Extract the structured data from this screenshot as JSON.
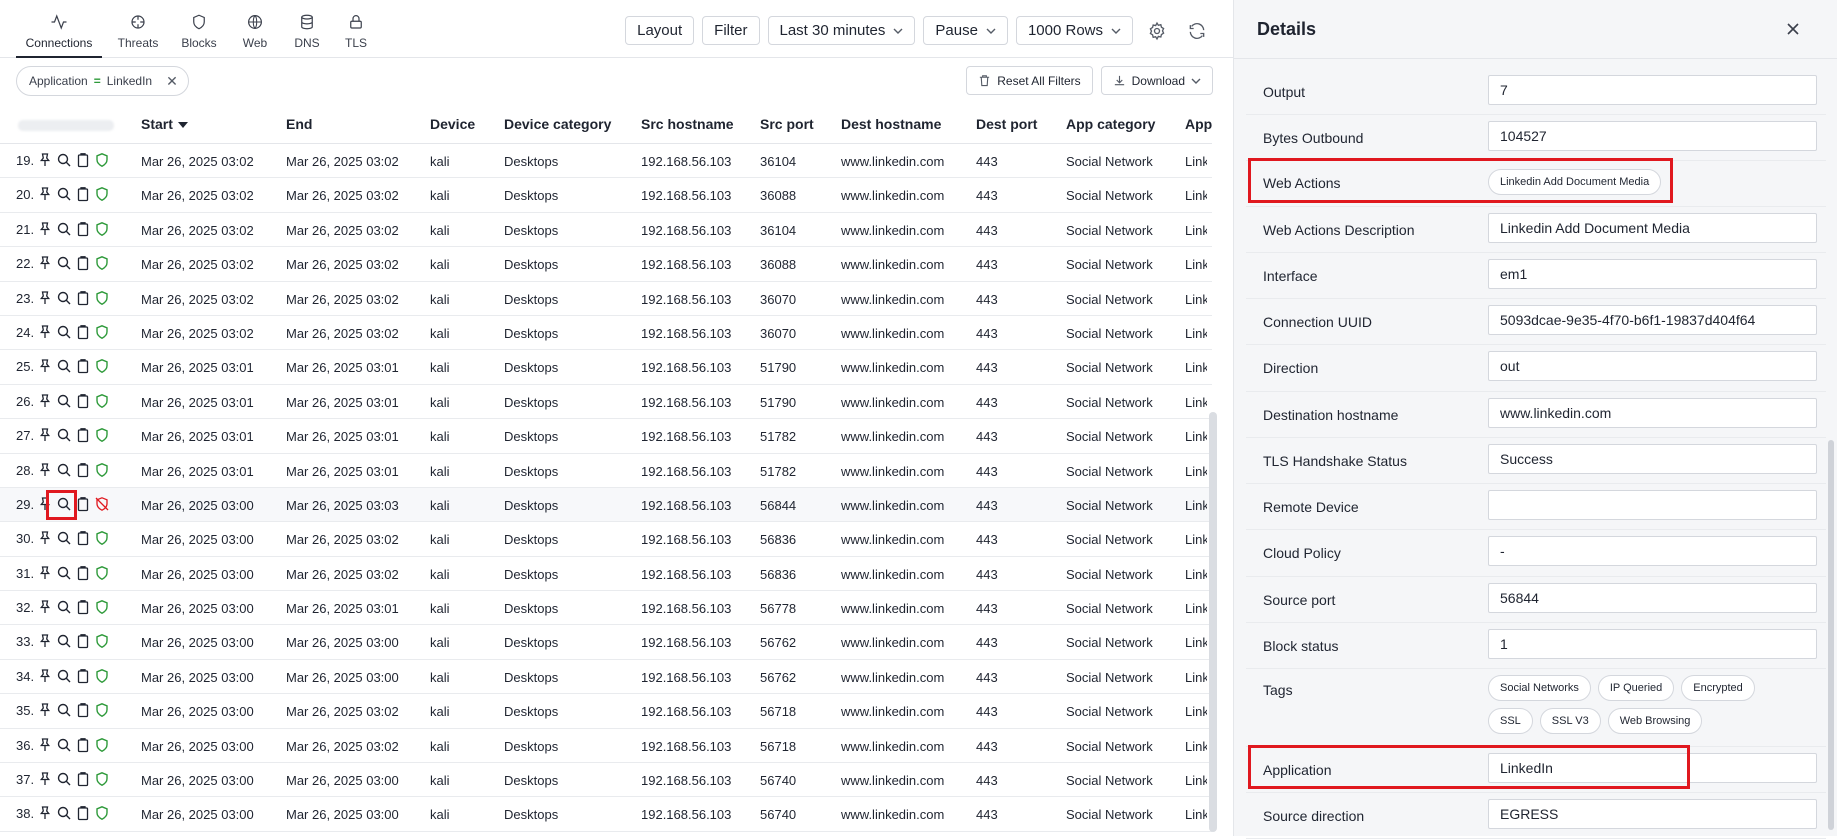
{
  "nav": {
    "tabs": [
      {
        "label": "Connections",
        "icon": "activity-icon",
        "active": true
      },
      {
        "label": "Threats",
        "icon": "crosshair-icon"
      },
      {
        "label": "Blocks",
        "icon": "shield-icon"
      },
      {
        "label": "Web",
        "icon": "globe-icon"
      },
      {
        "label": "DNS",
        "icon": "database-icon"
      },
      {
        "label": "TLS",
        "icon": "lock-icon"
      }
    ]
  },
  "toolbar": {
    "layout": "Layout",
    "filter": "Filter",
    "timerange": "Last 30 minutes",
    "pause": "Pause",
    "rows": "1000 Rows"
  },
  "filters": {
    "chip_field": "Application",
    "chip_op": "=",
    "chip_value": "LinkedIn",
    "reset": "Reset All Filters",
    "download": "Download"
  },
  "table": {
    "headers": {
      "start": "Start",
      "end": "End",
      "device": "Device",
      "device_category": "Device category",
      "src_hostname": "Src hostname",
      "src_port": "Src port",
      "dest_hostname": "Dest hostname",
      "dest_port": "Dest port",
      "app_category": "App category",
      "app": "App"
    },
    "rows": [
      {
        "num": "19.",
        "start": "Mar 26, 2025 03:02",
        "end": "Mar 26, 2025 03:02",
        "device": "kali",
        "cat": "Desktops",
        "src": "192.168.56.103",
        "sport": "36104",
        "dest": "www.linkedin.com",
        "dport": "443",
        "appcat": "Social Network",
        "app": "Link"
      },
      {
        "num": "20.",
        "start": "Mar 26, 2025 03:02",
        "end": "Mar 26, 2025 03:02",
        "device": "kali",
        "cat": "Desktops",
        "src": "192.168.56.103",
        "sport": "36088",
        "dest": "www.linkedin.com",
        "dport": "443",
        "appcat": "Social Network",
        "app": "Link"
      },
      {
        "num": "21.",
        "start": "Mar 26, 2025 03:02",
        "end": "Mar 26, 2025 03:02",
        "device": "kali",
        "cat": "Desktops",
        "src": "192.168.56.103",
        "sport": "36104",
        "dest": "www.linkedin.com",
        "dport": "443",
        "appcat": "Social Network",
        "app": "Link"
      },
      {
        "num": "22.",
        "start": "Mar 26, 2025 03:02",
        "end": "Mar 26, 2025 03:02",
        "device": "kali",
        "cat": "Desktops",
        "src": "192.168.56.103",
        "sport": "36088",
        "dest": "www.linkedin.com",
        "dport": "443",
        "appcat": "Social Network",
        "app": "Link"
      },
      {
        "num": "23.",
        "start": "Mar 26, 2025 03:02",
        "end": "Mar 26, 2025 03:02",
        "device": "kali",
        "cat": "Desktops",
        "src": "192.168.56.103",
        "sport": "36070",
        "dest": "www.linkedin.com",
        "dport": "443",
        "appcat": "Social Network",
        "app": "Link"
      },
      {
        "num": "24.",
        "start": "Mar 26, 2025 03:02",
        "end": "Mar 26, 2025 03:02",
        "device": "kali",
        "cat": "Desktops",
        "src": "192.168.56.103",
        "sport": "36070",
        "dest": "www.linkedin.com",
        "dport": "443",
        "appcat": "Social Network",
        "app": "Link"
      },
      {
        "num": "25.",
        "start": "Mar 26, 2025 03:01",
        "end": "Mar 26, 2025 03:01",
        "device": "kali",
        "cat": "Desktops",
        "src": "192.168.56.103",
        "sport": "51790",
        "dest": "www.linkedin.com",
        "dport": "443",
        "appcat": "Social Network",
        "app": "Link"
      },
      {
        "num": "26.",
        "start": "Mar 26, 2025 03:01",
        "end": "Mar 26, 2025 03:01",
        "device": "kali",
        "cat": "Desktops",
        "src": "192.168.56.103",
        "sport": "51790",
        "dest": "www.linkedin.com",
        "dport": "443",
        "appcat": "Social Network",
        "app": "Link"
      },
      {
        "num": "27.",
        "start": "Mar 26, 2025 03:01",
        "end": "Mar 26, 2025 03:01",
        "device": "kali",
        "cat": "Desktops",
        "src": "192.168.56.103",
        "sport": "51782",
        "dest": "www.linkedin.com",
        "dport": "443",
        "appcat": "Social Network",
        "app": "Link"
      },
      {
        "num": "28.",
        "start": "Mar 26, 2025 03:01",
        "end": "Mar 26, 2025 03:01",
        "device": "kali",
        "cat": "Desktops",
        "src": "192.168.56.103",
        "sport": "51782",
        "dest": "www.linkedin.com",
        "dport": "443",
        "appcat": "Social Network",
        "app": "Link"
      },
      {
        "num": "29.",
        "start": "Mar 26, 2025 03:00",
        "end": "Mar 26, 2025 03:03",
        "device": "kali",
        "cat": "Desktops",
        "src": "192.168.56.103",
        "sport": "56844",
        "dest": "www.linkedin.com",
        "dport": "443",
        "appcat": "Social Network",
        "app": "Link",
        "blocked": true,
        "selected": true
      },
      {
        "num": "30.",
        "start": "Mar 26, 2025 03:00",
        "end": "Mar 26, 2025 03:02",
        "device": "kali",
        "cat": "Desktops",
        "src": "192.168.56.103",
        "sport": "56836",
        "dest": "www.linkedin.com",
        "dport": "443",
        "appcat": "Social Network",
        "app": "Link"
      },
      {
        "num": "31.",
        "start": "Mar 26, 2025 03:00",
        "end": "Mar 26, 2025 03:02",
        "device": "kali",
        "cat": "Desktops",
        "src": "192.168.56.103",
        "sport": "56836",
        "dest": "www.linkedin.com",
        "dport": "443",
        "appcat": "Social Network",
        "app": "Link"
      },
      {
        "num": "32.",
        "start": "Mar 26, 2025 03:00",
        "end": "Mar 26, 2025 03:01",
        "device": "kali",
        "cat": "Desktops",
        "src": "192.168.56.103",
        "sport": "56778",
        "dest": "www.linkedin.com",
        "dport": "443",
        "appcat": "Social Network",
        "app": "Link"
      },
      {
        "num": "33.",
        "start": "Mar 26, 2025 03:00",
        "end": "Mar 26, 2025 03:00",
        "device": "kali",
        "cat": "Desktops",
        "src": "192.168.56.103",
        "sport": "56762",
        "dest": "www.linkedin.com",
        "dport": "443",
        "appcat": "Social Network",
        "app": "Link"
      },
      {
        "num": "34.",
        "start": "Mar 26, 2025 03:00",
        "end": "Mar 26, 2025 03:00",
        "device": "kali",
        "cat": "Desktops",
        "src": "192.168.56.103",
        "sport": "56762",
        "dest": "www.linkedin.com",
        "dport": "443",
        "appcat": "Social Network",
        "app": "Link"
      },
      {
        "num": "35.",
        "start": "Mar 26, 2025 03:00",
        "end": "Mar 26, 2025 03:02",
        "device": "kali",
        "cat": "Desktops",
        "src": "192.168.56.103",
        "sport": "56718",
        "dest": "www.linkedin.com",
        "dport": "443",
        "appcat": "Social Network",
        "app": "Link"
      },
      {
        "num": "36.",
        "start": "Mar 26, 2025 03:00",
        "end": "Mar 26, 2025 03:02",
        "device": "kali",
        "cat": "Desktops",
        "src": "192.168.56.103",
        "sport": "56718",
        "dest": "www.linkedin.com",
        "dport": "443",
        "appcat": "Social Network",
        "app": "Link"
      },
      {
        "num": "37.",
        "start": "Mar 26, 2025 03:00",
        "end": "Mar 26, 2025 03:00",
        "device": "kali",
        "cat": "Desktops",
        "src": "192.168.56.103",
        "sport": "56740",
        "dest": "www.linkedin.com",
        "dport": "443",
        "appcat": "Social Network",
        "app": "Link"
      },
      {
        "num": "38.",
        "start": "Mar 26, 2025 03:00",
        "end": "Mar 26, 2025 03:00",
        "device": "kali",
        "cat": "Desktops",
        "src": "192.168.56.103",
        "sport": "56740",
        "dest": "www.linkedin.com",
        "dport": "443",
        "appcat": "Social Network",
        "app": "Link"
      }
    ]
  },
  "details": {
    "title": "Details",
    "fields": [
      {
        "label": "Output",
        "value": "7"
      },
      {
        "label": "Bytes Outbound",
        "value": "104527"
      },
      {
        "label": "Web Actions",
        "pill": "Linkedin Add Document Media",
        "highlight": true
      },
      {
        "label": "Web Actions Description",
        "value": "Linkedin Add Document Media"
      },
      {
        "label": "Interface",
        "value": "em1"
      },
      {
        "label": "Connection UUID",
        "value": "5093dcae-9e35-4f70-b6f1-19837d404f64"
      },
      {
        "label": "Direction",
        "value": "out"
      },
      {
        "label": "Destination hostname",
        "value": "www.linkedin.com"
      },
      {
        "label": "TLS Handshake Status",
        "value": "Success"
      },
      {
        "label": "Remote Device",
        "value": ""
      },
      {
        "label": "Cloud Policy",
        "value": "-"
      },
      {
        "label": "Source port",
        "value": "56844"
      },
      {
        "label": "Block status",
        "value": "1"
      },
      {
        "label": "Tags",
        "tags": [
          [
            "Social Networks",
            "IP Queried",
            "Encrypted"
          ],
          [
            "SSL",
            "SSL V3",
            "Web Browsing"
          ]
        ]
      },
      {
        "label": "Application",
        "value": "LinkedIn",
        "highlight": true
      },
      {
        "label": "Source direction",
        "value": "EGRESS"
      }
    ]
  },
  "colors": {
    "highlight_box": "#e0181f",
    "shield_ok": "#2e9a3a",
    "shield_blocked": "#e0181f"
  }
}
